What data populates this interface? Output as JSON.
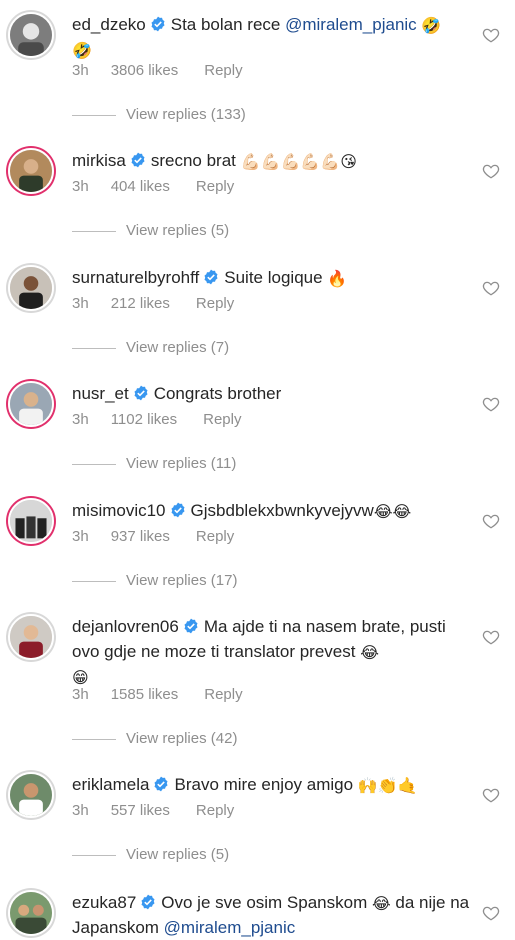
{
  "comments": [
    {
      "username": "ed_dzeko",
      "text": "Sta bolan rece ",
      "mention": "@miralem_pjanic",
      "emoji_after": "🤣",
      "line2_emoji": "🤣",
      "time": "3h",
      "likes": "3806 likes",
      "reply": "Reply",
      "view_replies": "View replies (133)",
      "avatar_icon": "profile-photo"
    },
    {
      "username": "mirkisa",
      "text": "srecno brat ",
      "emoji_after": "💪🏻💪🏻💪🏻💪🏻💪🏻😘",
      "time": "3h",
      "likes": "404 likes",
      "reply": "Reply",
      "view_replies": "View replies (5)"
    },
    {
      "username": "surnaturelbyrohff",
      "text": "Suite logique ",
      "emoji_after": "🔥",
      "time": "3h",
      "likes": "212 likes",
      "reply": "Reply",
      "view_replies": "View replies (7)"
    },
    {
      "username": "nusr_et",
      "text": "Congrats brother",
      "time": "3h",
      "likes": "1102 likes",
      "reply": "Reply",
      "view_replies": "View replies (11)"
    },
    {
      "username": "misimovic10",
      "text": "Gjsbdblekxbwnkyvejyvw",
      "emoji_after": "😂😂",
      "time": "3h",
      "likes": "937 likes",
      "reply": "Reply",
      "view_replies": "View replies (17)"
    },
    {
      "username": "dejanlovren06",
      "text": "Ma ajde ti na nasem brate, pusti ovo gdje ne moze ti translator prevest ",
      "emoji_after": "😂",
      "line2_emoji": "😁",
      "time": "3h",
      "likes": "1585 likes",
      "reply": "Reply",
      "view_replies": "View replies (42)"
    },
    {
      "username": "eriklamela",
      "text": "Bravo mire enjoy amigo ",
      "emoji_after": "🙌👏🤙",
      "time": "3h",
      "likes": "557 likes",
      "reply": "Reply",
      "view_replies": "View replies (5)"
    },
    {
      "username": "ezuka87",
      "text": "Ovo je sve osim Spanskom ",
      "emoji_after": "😂",
      "text_after": " da nije na Japanskom ",
      "mention": "@miralem_pjanic"
    }
  ],
  "colors": {
    "verified": "#3897f0",
    "mention": "#1f4c8f",
    "meta": "#8e8e8e",
    "story_ring": "#e1306c"
  },
  "icons": {
    "verified": "verified-badge-icon",
    "like": "heart-outline-icon"
  }
}
